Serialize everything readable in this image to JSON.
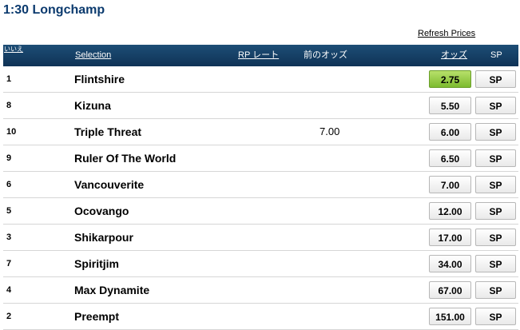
{
  "race": {
    "title": "1:30 Longchamp"
  },
  "refresh_label": "Refresh Prices",
  "header": {
    "number": "いいえ",
    "selection": "Selection",
    "rp": "RP レート",
    "prev_odds": "前のオッズ",
    "odds": "オッズ",
    "sp": "SP"
  },
  "colors": {
    "header_bg": "#0f3356",
    "title": "#0b3a6e",
    "selected_odds": "#8dc63f"
  },
  "runners": [
    {
      "num": "1",
      "name": "Flintshire",
      "prev": "",
      "odds": "2.75",
      "sp": "SP",
      "selected": true
    },
    {
      "num": "8",
      "name": "Kizuna",
      "prev": "",
      "odds": "5.50",
      "sp": "SP",
      "selected": false
    },
    {
      "num": "10",
      "name": "Triple Threat",
      "prev": "7.00",
      "odds": "6.00",
      "sp": "SP",
      "selected": false
    },
    {
      "num": "9",
      "name": "Ruler Of The World",
      "prev": "",
      "odds": "6.50",
      "sp": "SP",
      "selected": false
    },
    {
      "num": "6",
      "name": "Vancouverite",
      "prev": "",
      "odds": "7.00",
      "sp": "SP",
      "selected": false
    },
    {
      "num": "5",
      "name": "Ocovango",
      "prev": "",
      "odds": "12.00",
      "sp": "SP",
      "selected": false
    },
    {
      "num": "3",
      "name": "Shikarpour",
      "prev": "",
      "odds": "17.00",
      "sp": "SP",
      "selected": false
    },
    {
      "num": "7",
      "name": "Spiritjim",
      "prev": "",
      "odds": "34.00",
      "sp": "SP",
      "selected": false
    },
    {
      "num": "4",
      "name": "Max Dynamite",
      "prev": "",
      "odds": "67.00",
      "sp": "SP",
      "selected": false
    },
    {
      "num": "2",
      "name": "Preempt",
      "prev": "",
      "odds": "151.00",
      "sp": "SP",
      "selected": false
    }
  ]
}
